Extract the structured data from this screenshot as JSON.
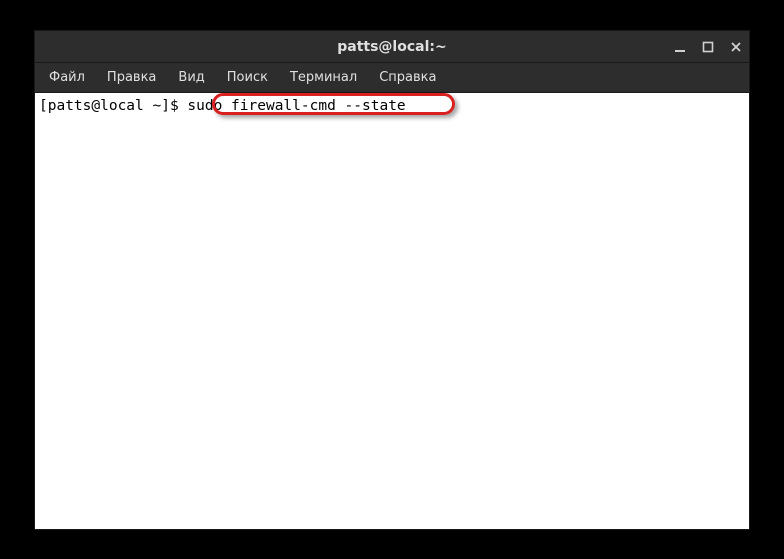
{
  "window": {
    "title": "patts@local:~"
  },
  "menubar": {
    "items": [
      "Файл",
      "Правка",
      "Вид",
      "Поиск",
      "Терминал",
      "Справка"
    ]
  },
  "terminal": {
    "prompt": "[patts@local ~]$ ",
    "command": "sudo firewall-cmd --state"
  },
  "annotation": {
    "type": "highlight-oval",
    "color": "#d92020"
  }
}
